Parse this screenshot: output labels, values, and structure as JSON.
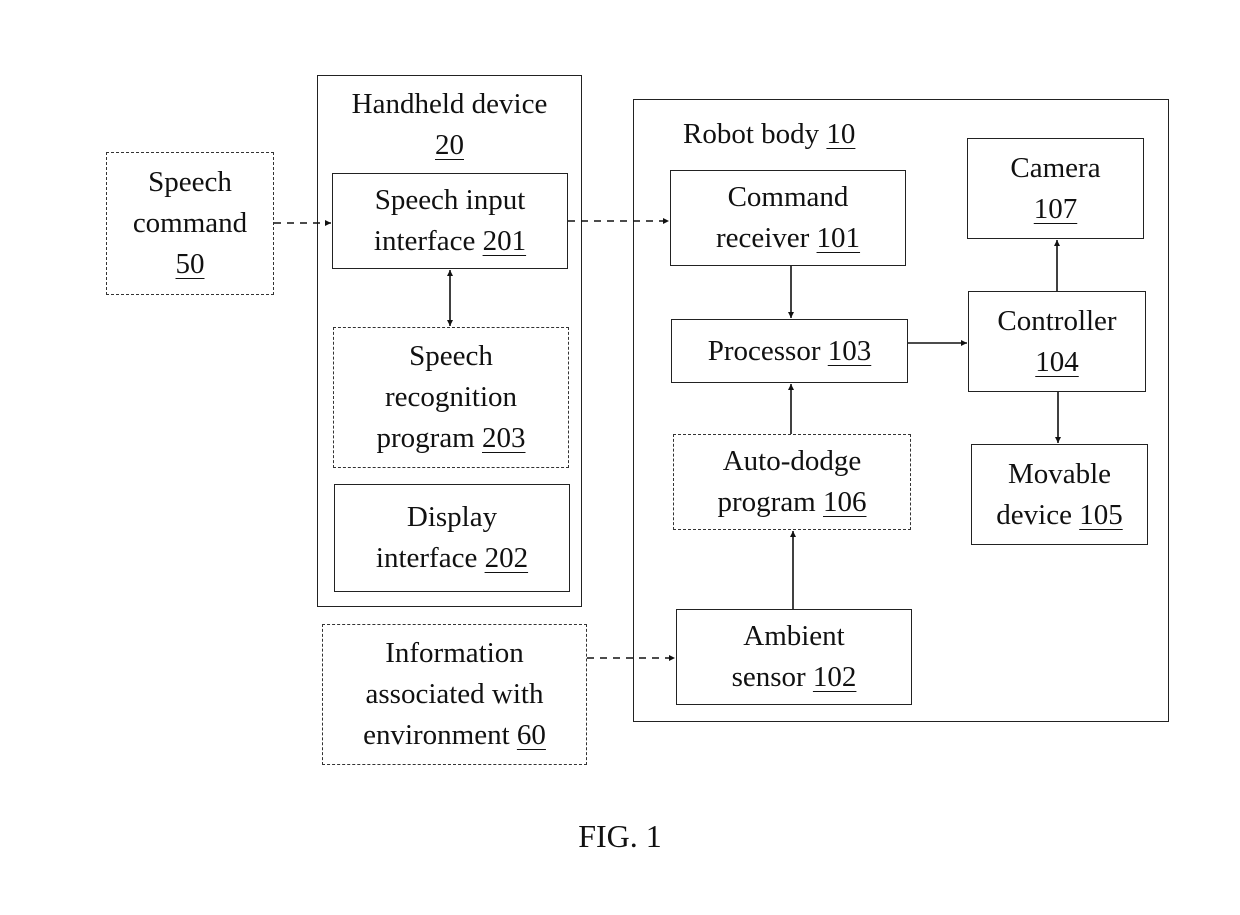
{
  "figure": {
    "caption": "FIG. 1",
    "containers": {
      "handheld": {
        "title": "Handheld device",
        "ref": "20"
      },
      "robot": {
        "title": "Robot body",
        "ref": "10"
      }
    },
    "blocks": {
      "speech_command": {
        "lines": [
          "Speech",
          "command"
        ],
        "ref": "50",
        "style": "dashed"
      },
      "speech_input": {
        "lines": [
          "Speech input",
          "interface"
        ],
        "ref": "201",
        "style": "solid"
      },
      "speech_recognition": {
        "lines": [
          "Speech",
          "recognition",
          "program"
        ],
        "ref": "203",
        "style": "dashed"
      },
      "display_interface": {
        "lines": [
          "Display",
          "interface"
        ],
        "ref": "202",
        "style": "solid"
      },
      "environment_info": {
        "lines": [
          "Information",
          "associated with",
          "environment"
        ],
        "ref": "60",
        "style": "dashed"
      },
      "command_receiver": {
        "lines": [
          "Command",
          "receiver"
        ],
        "ref": "101",
        "style": "solid"
      },
      "processor": {
        "lines": [
          "Processor"
        ],
        "ref": "103",
        "style": "solid"
      },
      "auto_dodge": {
        "lines": [
          "Auto-dodge",
          "program"
        ],
        "ref": "106",
        "style": "dashed"
      },
      "ambient_sensor": {
        "lines": [
          "Ambient",
          "sensor"
        ],
        "ref": "102",
        "style": "solid"
      },
      "camera": {
        "lines": [
          "Camera"
        ],
        "ref": "107",
        "style": "solid"
      },
      "controller": {
        "lines": [
          "Controller"
        ],
        "ref": "104",
        "style": "solid"
      },
      "movable_device": {
        "lines": [
          "Movable",
          "device"
        ],
        "ref": "105",
        "style": "solid"
      }
    },
    "connections": [
      {
        "from": "speech_command",
        "to": "speech_input",
        "style": "dashed",
        "direction": "forward"
      },
      {
        "from": "speech_input",
        "to": "command_receiver",
        "style": "dashed",
        "direction": "forward"
      },
      {
        "from": "speech_input",
        "to": "speech_recognition",
        "style": "solid",
        "direction": "both"
      },
      {
        "from": "command_receiver",
        "to": "processor",
        "style": "solid",
        "direction": "forward"
      },
      {
        "from": "processor",
        "to": "controller",
        "style": "solid",
        "direction": "forward"
      },
      {
        "from": "controller",
        "to": "camera",
        "style": "solid",
        "direction": "forward"
      },
      {
        "from": "controller",
        "to": "movable_device",
        "style": "solid",
        "direction": "forward"
      },
      {
        "from": "auto_dodge",
        "to": "processor",
        "style": "solid",
        "direction": "forward"
      },
      {
        "from": "ambient_sensor",
        "to": "auto_dodge",
        "style": "solid",
        "direction": "forward"
      },
      {
        "from": "environment_info",
        "to": "ambient_sensor",
        "style": "dashed",
        "direction": "forward"
      }
    ]
  }
}
